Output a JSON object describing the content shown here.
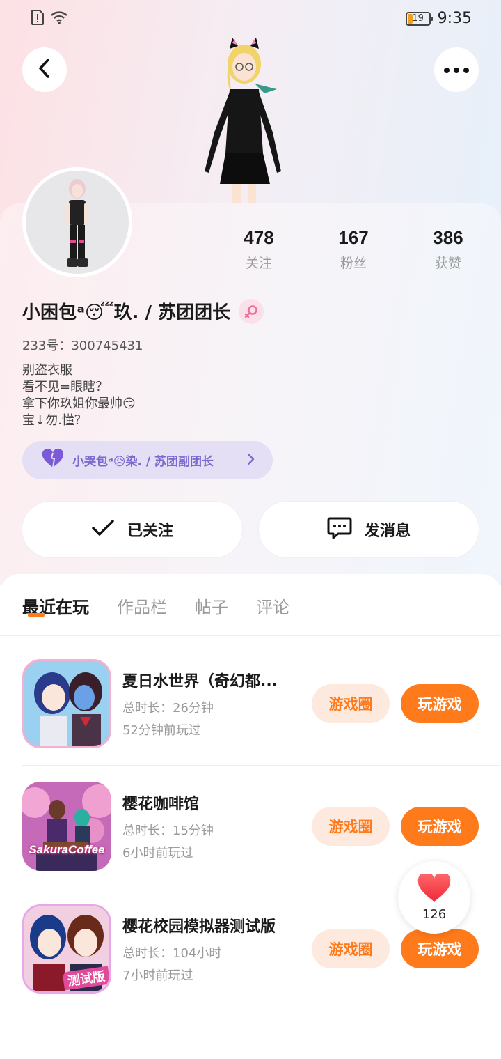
{
  "status_bar": {
    "battery_level": "19",
    "time": "9:35",
    "icons": [
      "alert-sim-icon",
      "wifi-icon",
      "battery-icon"
    ]
  },
  "header": {
    "back_icon": "chevron-left-icon",
    "more_icon": "more-dots-icon"
  },
  "profile": {
    "stats": [
      {
        "value": "478",
        "label": "关注"
      },
      {
        "value": "167",
        "label": "粉丝"
      },
      {
        "value": "386",
        "label": "获赞"
      }
    ],
    "nickname": "小困包ᵃ😴玖. / 苏团团长",
    "gender_icon": "female-icon",
    "uid": "233号：300745431",
    "bio_lines": [
      "别盗衣服",
      "看不见=眼瞎？",
      "拿下你玖姐你最帅😏",
      "宝↓勿.懂？"
    ],
    "relation": {
      "icon": "heart-icon",
      "text": "小哭包ᵃ😥染. / 苏团副团长"
    }
  },
  "actions": {
    "follow_label": "已关注",
    "message_label": "发消息"
  },
  "tabs": [
    {
      "label": "最近在玩",
      "active": true
    },
    {
      "label": "作品栏",
      "active": false
    },
    {
      "label": "帖子",
      "active": false
    },
    {
      "label": "评论",
      "active": false
    }
  ],
  "games": [
    {
      "name": "夏日水世界（奇幻都...",
      "duration": "总时长：26分钟",
      "last_played": "52分钟前玩过",
      "circle_label": "游戏圈",
      "play_label": "玩游戏"
    },
    {
      "name": "樱花咖啡馆",
      "duration": "总时长：15分钟",
      "last_played": "6小时前玩过",
      "circle_label": "游戏圈",
      "play_label": "玩游戏",
      "icon_text": "SakuraCoffee"
    },
    {
      "name": "樱花校园模拟器测试版",
      "duration": "总时长：104小时",
      "last_played": "7小时前玩过",
      "circle_label": "游戏圈",
      "play_label": "玩游戏",
      "icon_text": "测试版"
    }
  ],
  "like_float": {
    "icon": "heart-icon",
    "count": "126"
  },
  "colors": {
    "accent": "#ff7a1a",
    "accent_light": "#fde9dd",
    "relation_bg": "#e4dff5",
    "relation_text": "#7a6ad0"
  }
}
